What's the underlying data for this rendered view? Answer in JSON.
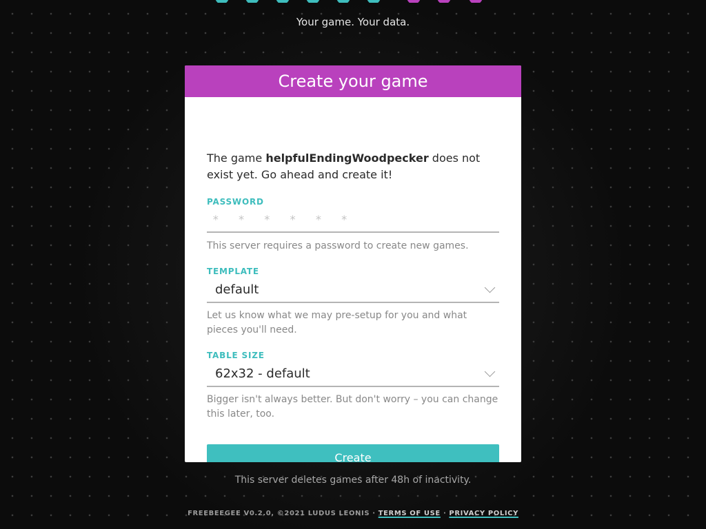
{
  "logo": {
    "colors": [
      "#3ebdbd",
      "#3ebdbd",
      "#3ebdbd",
      "#3ebdbd",
      "#3ebdbd",
      "#3ebdbd",
      "#b941bd",
      "#b941bd",
      "#b941bd"
    ]
  },
  "tagline": "Your game. Your data.",
  "card": {
    "title": "Create your game",
    "intro_prefix": "The game ",
    "game_name": "helpfulEndingWoodpecker",
    "intro_suffix": " does not exist yet. Go ahead and create it!",
    "password": {
      "label": "PASSWORD",
      "placeholder": "* * * * * *",
      "hint": "This server requires a password to create new games."
    },
    "template": {
      "label": "TEMPLATE",
      "value": "default",
      "hint": "Let us know what we may pre-setup for you and what pieces you'll need."
    },
    "table_size": {
      "label": "TABLE SIZE",
      "value": "62x32 - default",
      "hint": "Bigger isn't always better. But don't worry – you can change this later, too."
    },
    "create_label": "Create"
  },
  "footer": {
    "note": "This server deletes games after 48h of inactivity.",
    "legal_prefix": "FREEBEEGEE V0.2.0, ©2021 LUDUS LEONIS · ",
    "terms": "TERMS OF USE",
    "separator": " · ",
    "privacy": "PRIVACY POLICY"
  },
  "colors": {
    "header": "#b941bd",
    "accent": "#3fbfbf",
    "background": "#0c0c0c"
  }
}
